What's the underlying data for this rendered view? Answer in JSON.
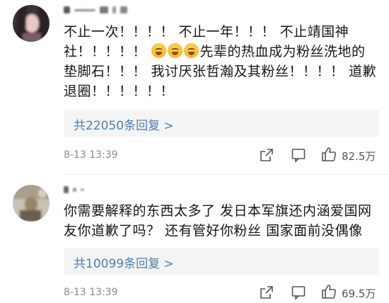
{
  "comments": [
    {
      "text_parts": [
        "不止一次！！！！ 不止一年！！！ 不止靖国神社！！！！！ ",
        "先辈的热血成为粉丝洗地的垫脚石！！！ 我讨厌张哲瀚及其粉丝！！！！ 道歉退圈！！！！！！"
      ],
      "emoji_icons": [
        "crying-emoji-icon",
        "crying-emoji-icon",
        "crying-emoji-icon"
      ],
      "reply_label": "共22050条回复 >",
      "time": "8-13 13:39",
      "likes": "82.5万"
    },
    {
      "text_parts": [
        "你需要解释的东西太多了 发日本军旗还内涵爱国网友你道歉了吗？ 还有管好你粉丝 国家面前没偶像"
      ],
      "reply_label": "共10099条回复 >",
      "time": "8-13 13:39",
      "likes": "69.5万"
    }
  ],
  "colors": {
    "link": "#507daf",
    "meta": "#8a8a8a",
    "reply_bg": "#f4f4f4"
  }
}
